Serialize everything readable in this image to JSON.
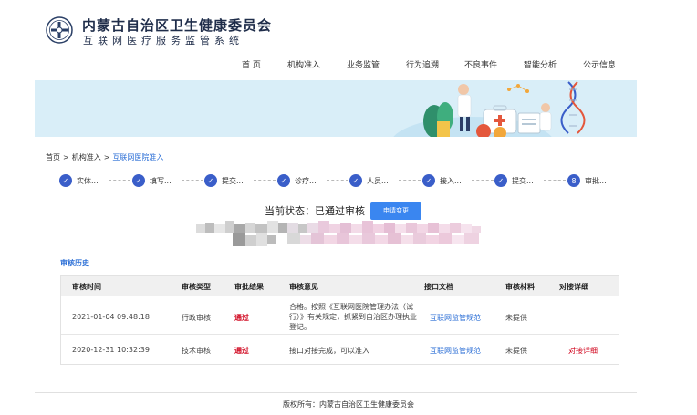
{
  "header": {
    "org_name": "内蒙古自治区卫生健康委员会",
    "sys_name": "互联网医疗服务监管系统"
  },
  "nav": {
    "items": [
      "首 页",
      "机构准入",
      "业务监管",
      "行为追溯",
      "不良事件",
      "智能分析",
      "公示信息"
    ]
  },
  "breadcrumb": {
    "items": [
      "首页",
      "机构准入",
      "互联网医院准入"
    ],
    "separator": ">"
  },
  "steps": [
    {
      "num": "✓",
      "label": "实体..."
    },
    {
      "num": "✓",
      "label": "填写..."
    },
    {
      "num": "✓",
      "label": "提交..."
    },
    {
      "num": "✓",
      "label": "诊疗..."
    },
    {
      "num": "✓",
      "label": "人员..."
    },
    {
      "num": "✓",
      "label": "接入..."
    },
    {
      "num": "✓",
      "label": "提交..."
    },
    {
      "num": "8",
      "label": "审批..."
    }
  ],
  "status": {
    "label": "当前状态：",
    "value": "已通过审核",
    "apply_button": "申请变更"
  },
  "history": {
    "title": "审核历史",
    "columns": [
      "审核时间",
      "审核类型",
      "审批结果",
      "审核意见",
      "接口文档",
      "审核材料",
      "对接详细"
    ],
    "rows": [
      {
        "time": "2021-01-04 09:48:18",
        "type": "行政审核",
        "result": "通过",
        "opinion": "合格。按照《互联网医院管理办法（试行）》有关规定，抓紧到自治区办理执业登记。",
        "doc": "互联网监管规范",
        "material": "未提供",
        "detail": ""
      },
      {
        "time": "2020-12-31 10:32:39",
        "type": "技术审核",
        "result": "通过",
        "opinion": "接口对接完成，可以准入",
        "doc": "互联网监管规范",
        "material": "未提供",
        "detail": "对接详细"
      }
    ]
  },
  "footer": {
    "copyright": "版权所有：内蒙古自治区卫生健康委员会"
  },
  "colors": {
    "accent": "#3a5ec9",
    "button": "#3a86f0",
    "link": "#2c6fd6",
    "pass": "#d0021b",
    "banner_bg": "#d9eef8"
  }
}
